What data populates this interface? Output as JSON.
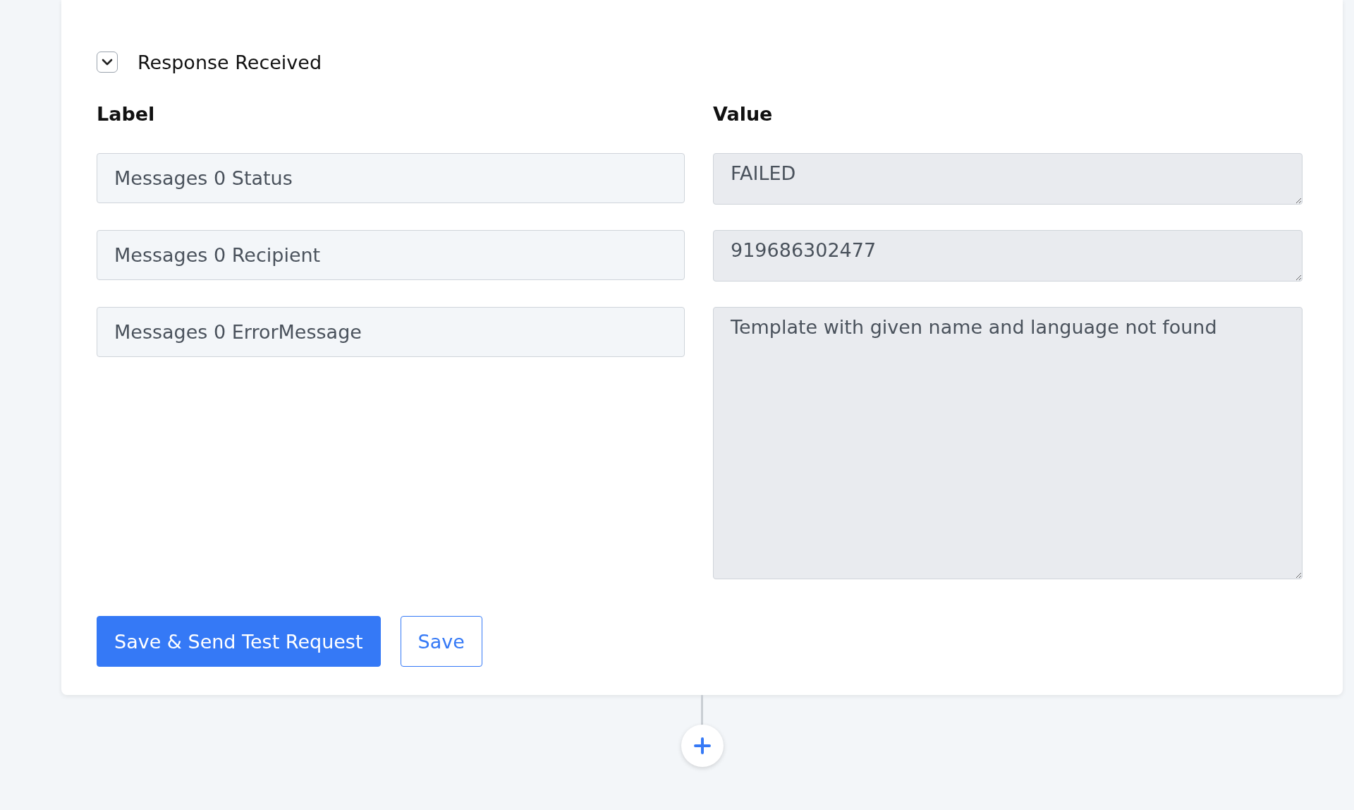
{
  "section": {
    "title": "Response Received",
    "expanded": true
  },
  "columns": {
    "label": "Label",
    "value": "Value"
  },
  "rows": [
    {
      "label": "Messages 0 Status",
      "value": "FAILED",
      "kind": "short"
    },
    {
      "label": "Messages 0 Recipient",
      "value": "919686302477",
      "kind": "short"
    },
    {
      "label": "Messages 0 ErrorMessage",
      "value": "Template with given name and language not found",
      "kind": "tall"
    }
  ],
  "buttons": [
    {
      "label": "Save & Send Test Request",
      "kind": "primary"
    },
    {
      "label": "Save",
      "kind": "outline"
    }
  ]
}
